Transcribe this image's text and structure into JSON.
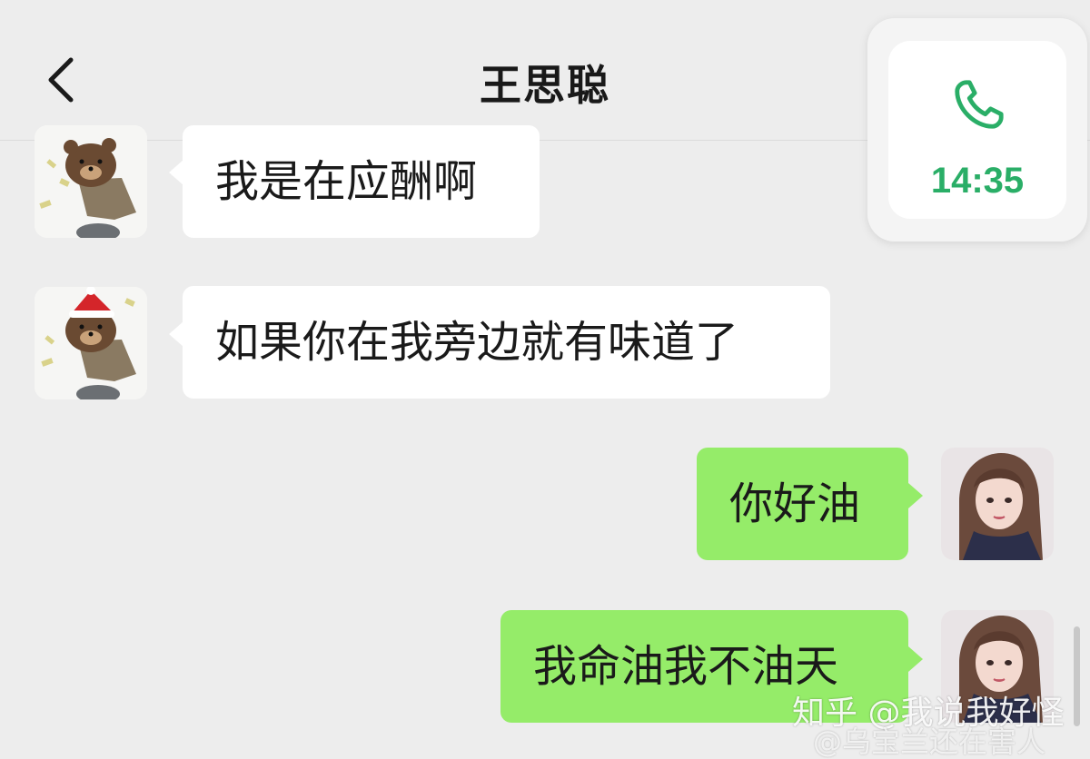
{
  "header": {
    "title": "王思聪"
  },
  "call_float": {
    "time": "14:35",
    "icon": "phone-icon",
    "accent": "#2aae67"
  },
  "messages": [
    {
      "side": "in",
      "text": "我是在应酬啊",
      "avatar": "bear-avatar"
    },
    {
      "side": "in",
      "text": "如果你在我旁边就有味道了",
      "avatar": "bear-avatar"
    },
    {
      "side": "out",
      "text": "你好油",
      "avatar": "girl-avatar"
    },
    {
      "side": "out",
      "text": "我命油我不油天",
      "avatar": "girl-avatar"
    }
  ],
  "colors": {
    "background": "#ededed",
    "incoming_bubble": "#ffffff",
    "outgoing_bubble": "#95ec69"
  },
  "watermark": {
    "line1": "知乎 @我说我好怪",
    "line2": "@乌宝兰还在害人"
  }
}
